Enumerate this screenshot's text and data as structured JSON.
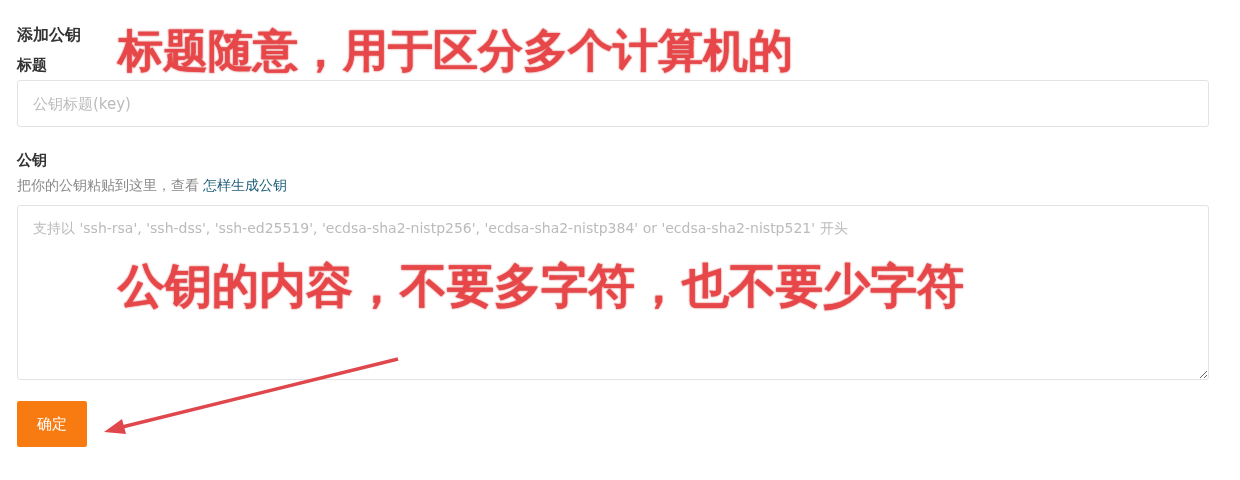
{
  "heading": "添加公钥",
  "title_field": {
    "label": "标题",
    "placeholder": "公钥标题(key)"
  },
  "key_field": {
    "label": "公钥",
    "hint": "把你的公钥粘贴到这里，查看",
    "hint_link": "怎样生成公钥",
    "placeholder": "支持以 'ssh-rsa', 'ssh-dss', 'ssh-ed25519', 'ecdsa-sha2-nistp256', 'ecdsa-sha2-nistp384' or 'ecdsa-sha2-nistp521' 开头"
  },
  "submit_button": "确定",
  "annotations": [
    "标题随意，用于区分多个计算机的",
    "公钥的内容，不要多字符，也不要少字符"
  ]
}
